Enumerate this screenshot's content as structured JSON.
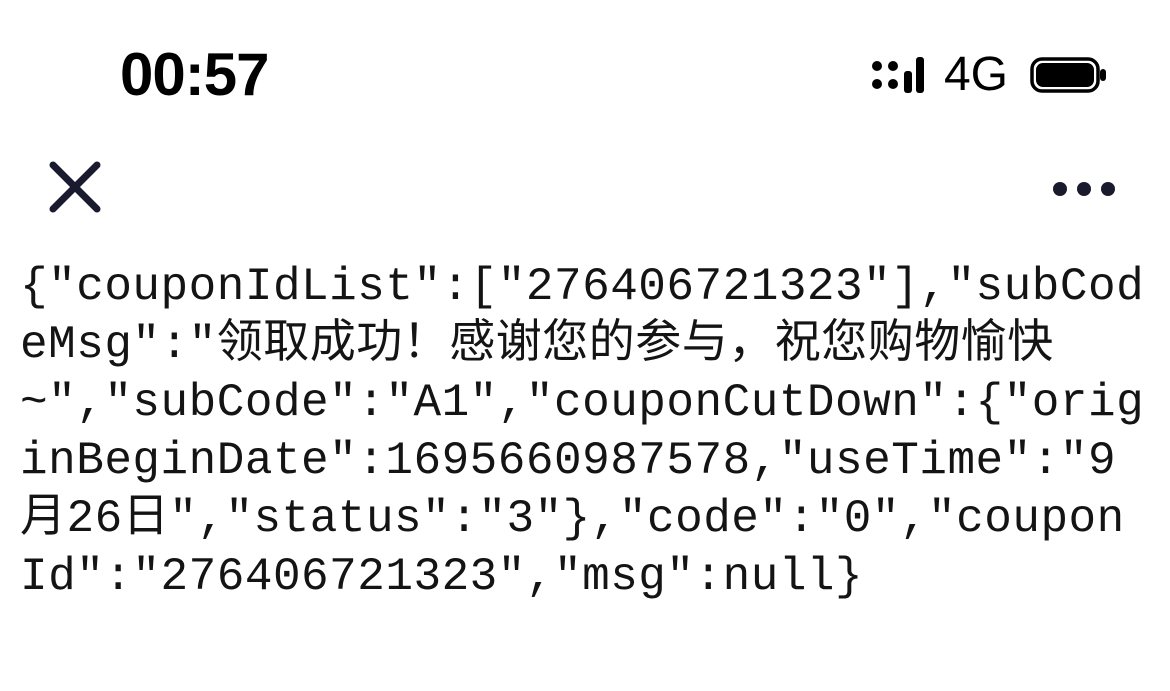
{
  "statusBar": {
    "time": "00:57",
    "networkLabel": "4G"
  },
  "content": {
    "jsonText": "{\"couponIdList\":[\"276406721323\"],\"subCodeMsg\":\"领取成功！感谢您的参与，祝您购物愉快~\",\"subCode\":\"A1\",\"couponCutDown\":{\"originBeginDate\":1695660987578,\"useTime\":\"9月26日\",\"status\":\"3\"},\"code\":\"0\",\"couponId\":\"276406721323\",\"msg\":null}"
  }
}
